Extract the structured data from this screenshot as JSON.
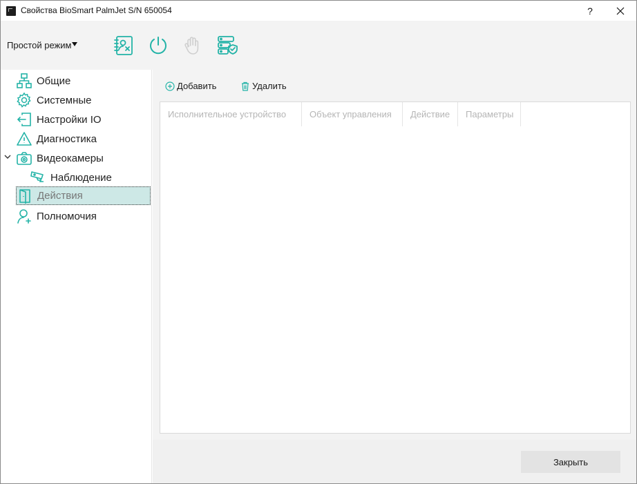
{
  "window": {
    "title": "Свойства BioSmart PalmJet S/N 650054",
    "help_label": "?",
    "close_label": "✕"
  },
  "toolbar": {
    "mode_label": "Простой режим",
    "icons": [
      "contact-book-remove-icon",
      "power-icon",
      "palm-icon",
      "server-shield-icon"
    ]
  },
  "sidebar": {
    "items": [
      {
        "label": "Общие",
        "icon": "network-icon"
      },
      {
        "label": "Системные",
        "icon": "gear-icon"
      },
      {
        "label": "Настройки IO",
        "icon": "login-arrow-icon"
      },
      {
        "label": "Диагностика",
        "icon": "warning-icon"
      },
      {
        "label": "Видеокамеры",
        "icon": "camera-icon",
        "expanded": true
      },
      {
        "label": "Наблюдение",
        "icon": "cctv-icon"
      },
      {
        "label": "Действия",
        "icon": "door-icon",
        "selected": true
      },
      {
        "label": "Полномочия",
        "icon": "user-add-icon"
      }
    ]
  },
  "main": {
    "add_label": "Добавить",
    "delete_label": "Удалить",
    "columns": [
      "Исполнительное устройство",
      "Объект управления",
      "Действие",
      "Параметры"
    ],
    "rows": [],
    "close_button_label": "Закрыть"
  },
  "colors": {
    "accent": "#23b3a7",
    "selection": "#cde8e6",
    "toolbar_bg": "#f3f3f3",
    "header_text": "#b5b5b5"
  }
}
